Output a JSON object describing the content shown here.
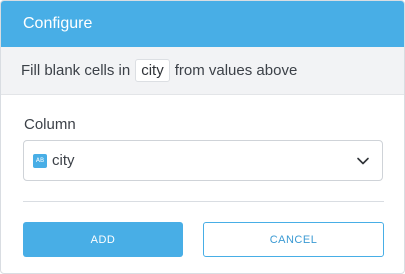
{
  "dialog": {
    "title": "Configure",
    "description": {
      "prefix": "Fill blank cells in",
      "column": "city",
      "suffix": "from values above"
    },
    "field": {
      "label": "Column",
      "selected_value": "city",
      "type_icon_text": "AB",
      "type_icon": "text-type-icon"
    },
    "buttons": {
      "add": "ADD",
      "cancel": "CANCEL"
    }
  },
  "colors": {
    "accent": "#48aee6",
    "background": "#ffffff",
    "subheader_bg": "#f2f3f5",
    "text": "#3c4148"
  }
}
